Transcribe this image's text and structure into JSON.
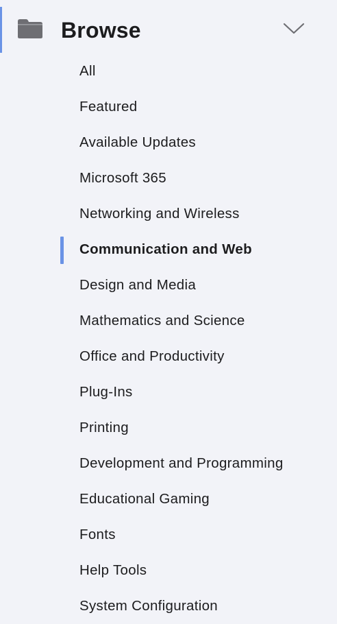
{
  "header": {
    "title": "Browse",
    "icon": "folder-icon",
    "toggle_icon": "chevron-down-icon",
    "accent_color": "#6a93e6"
  },
  "menu": {
    "active_index": 5,
    "items": [
      {
        "label": "All"
      },
      {
        "label": "Featured"
      },
      {
        "label": "Available Updates"
      },
      {
        "label": "Microsoft 365"
      },
      {
        "label": "Networking and Wireless"
      },
      {
        "label": "Communication and Web"
      },
      {
        "label": "Design and Media"
      },
      {
        "label": "Mathematics and Science"
      },
      {
        "label": "Office and Productivity"
      },
      {
        "label": "Plug-Ins"
      },
      {
        "label": "Printing"
      },
      {
        "label": "Development and Programming"
      },
      {
        "label": "Educational Gaming"
      },
      {
        "label": "Fonts"
      },
      {
        "label": "Help Tools"
      },
      {
        "label": "System Configuration"
      }
    ]
  }
}
